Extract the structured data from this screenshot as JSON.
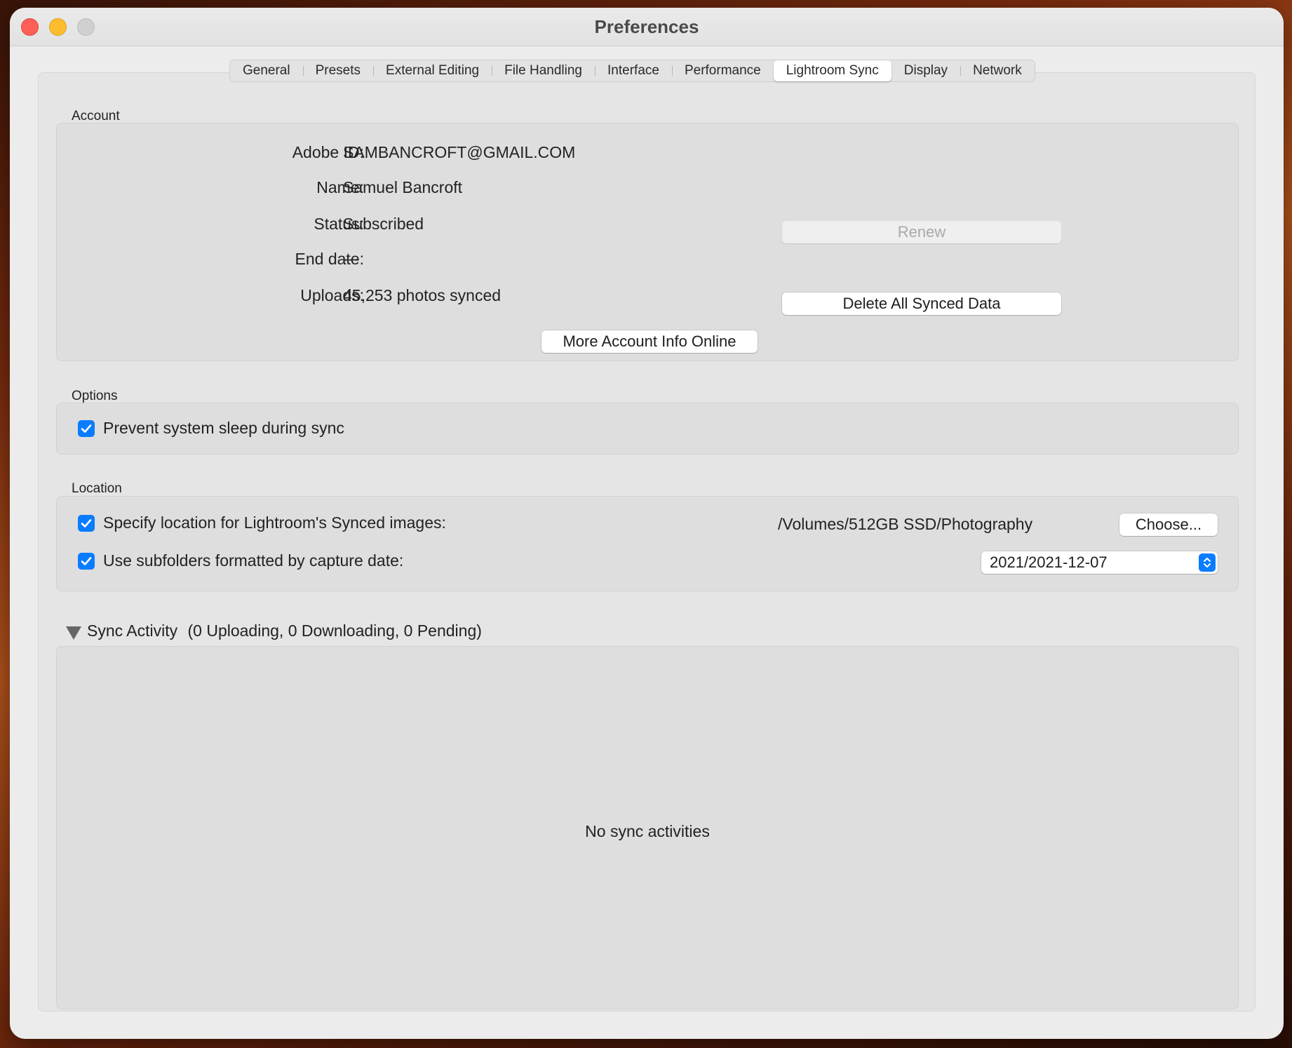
{
  "window": {
    "title": "Preferences"
  },
  "tabs": [
    {
      "label": "General"
    },
    {
      "label": "Presets"
    },
    {
      "label": "External Editing"
    },
    {
      "label": "File Handling"
    },
    {
      "label": "Interface"
    },
    {
      "label": "Performance"
    },
    {
      "label": "Lightroom Sync",
      "active": true
    },
    {
      "label": "Display"
    },
    {
      "label": "Network"
    }
  ],
  "account": {
    "section_label": "Account",
    "adobe_id_label": "Adobe ID:",
    "adobe_id_value": "SAMBANCROFT@GMAIL.COM",
    "name_label": "Name:",
    "name_value": "Samuel Bancroft",
    "status_label": "Status:",
    "status_value": "Subscribed",
    "end_date_label": "End date:",
    "end_date_value": "---",
    "uploads_label": "Uploads:",
    "uploads_value": "45,253 photos synced",
    "renew_button": "Renew",
    "delete_button": "Delete All Synced Data",
    "more_info_button": "More Account Info Online"
  },
  "options": {
    "section_label": "Options",
    "prevent_sleep_label": "Prevent system sleep during sync",
    "prevent_sleep_checked": true
  },
  "location": {
    "section_label": "Location",
    "specify_location_label": "Specify location for Lightroom's Synced images:",
    "specify_location_checked": true,
    "path_value": "/Volumes/512GB SSD/Photography",
    "choose_button": "Choose...",
    "subfolders_label": "Use subfolders formatted by capture date:",
    "subfolders_checked": true,
    "date_format_selected": "2021/2021-12-07"
  },
  "sync_activity": {
    "title": "Sync Activity",
    "counts": "(0 Uploading, 0 Downloading, 0 Pending)",
    "empty_message": "No sync activities"
  },
  "colors": {
    "accent": "#0a7cff",
    "close": "#fe5f57",
    "minimize": "#febc2e",
    "zoom_inactive": "#d0d0d0"
  }
}
